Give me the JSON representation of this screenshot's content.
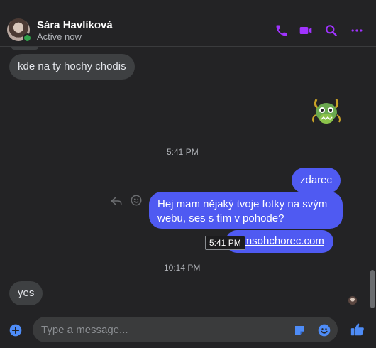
{
  "colors": {
    "background": "#232325",
    "accent": "#a033ff",
    "outgoing_bubble": "#4f5af2",
    "incoming_bubble": "#3e4042",
    "online": "#31a24c",
    "like": "#4e8cf7"
  },
  "header": {
    "contact_name": "Sára Havlíková",
    "status": "Active now",
    "actions": [
      "phone-icon",
      "video-icon",
      "search-icon",
      "more-icon"
    ]
  },
  "messages": [
    {
      "kind": "incoming",
      "text": "kde na ty hochy chodis"
    },
    {
      "kind": "sticker",
      "icon": "dragon-sticker-icon"
    },
    {
      "kind": "time",
      "text": "5:41 PM"
    },
    {
      "kind": "outgoing",
      "text": "zdarec"
    },
    {
      "kind": "outgoing",
      "text": "Hej mam nějaký tvoje fotky na svým webu, ses s tím v pohode?"
    },
    {
      "kind": "outgoing",
      "text": "jamsohchorec.com",
      "is_link": true
    },
    {
      "kind": "time",
      "text": "10:14 PM"
    },
    {
      "kind": "incoming",
      "text": "yes"
    }
  ],
  "tooltip": "5:41 PM",
  "composer": {
    "placeholder": "Type a message...",
    "icons": [
      "add-icon",
      "sticker-icon",
      "emoji-icon",
      "thumbs-up-icon"
    ]
  }
}
